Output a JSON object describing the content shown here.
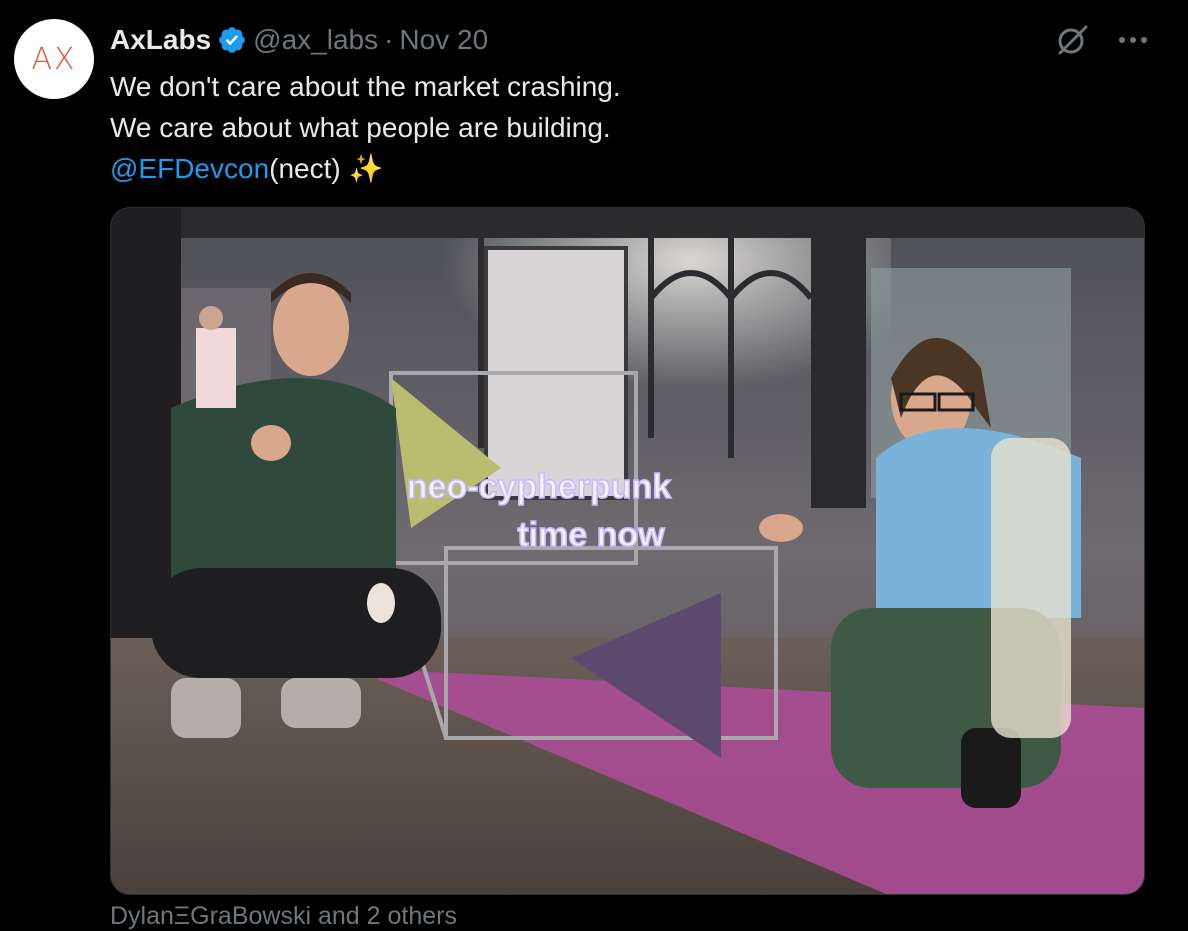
{
  "tweet": {
    "avatar_text": "AX",
    "display_name": "AxLabs",
    "handle": "@ax_labs",
    "separator": "·",
    "date": "Nov 20",
    "text_line1": "We don't care about the market crashing.",
    "text_line2": "We care about what people are building.",
    "mention": "@EFDevcon",
    "mention_suffix": "(nect) ✨",
    "media_caption": {
      "line1": "neo-cypherpunk",
      "line2": "time now"
    },
    "tagged_people": "DylanΞGraBowski and 2 others"
  },
  "icons": {
    "verified": "verified-badge-icon",
    "grok": "grok-icon",
    "more": "more-icon"
  },
  "colors": {
    "background": "#000000",
    "text": "#e7e9ea",
    "muted": "#71767b",
    "link": "#1d9bf0",
    "avatar_text": "#d9573a"
  }
}
